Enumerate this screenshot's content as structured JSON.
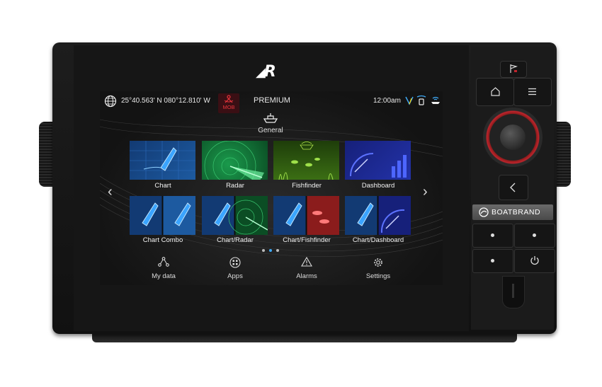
{
  "device": {
    "brand_logo": "R",
    "panel_brand": "BOATBRAND"
  },
  "status_bar": {
    "coordinates": "25°40.563' N  080°12.810' W",
    "mob_label": "MOB",
    "mode": "PREMIUM",
    "time": "12:00am"
  },
  "home": {
    "group_label": "General",
    "apps": [
      {
        "label": "Chart"
      },
      {
        "label": "Radar"
      },
      {
        "label": "Fishfinder"
      },
      {
        "label": "Dashboard"
      },
      {
        "label": "Chart Combo"
      },
      {
        "label": "Chart/Radar"
      },
      {
        "label": "Chart/Fishfinder"
      },
      {
        "label": "Chart/Dashboard"
      }
    ],
    "page_indicator": {
      "pages": 3,
      "current": 2
    }
  },
  "nav": {
    "items": [
      {
        "label": "My data",
        "icon": "share-nodes-icon"
      },
      {
        "label": "Apps",
        "icon": "apps-grid-icon"
      },
      {
        "label": "Alarms",
        "icon": "warning-triangle-icon"
      },
      {
        "label": "Settings",
        "icon": "gear-icon"
      }
    ]
  },
  "colors": {
    "chart_blue": "#1d5aa0",
    "radar_green": "#0c8a3e",
    "fishfinder_green": "#3b6e14",
    "dashboard_blue": "#2332a8",
    "mob_red": "#e8343b",
    "rotary_red": "#c0242c"
  }
}
